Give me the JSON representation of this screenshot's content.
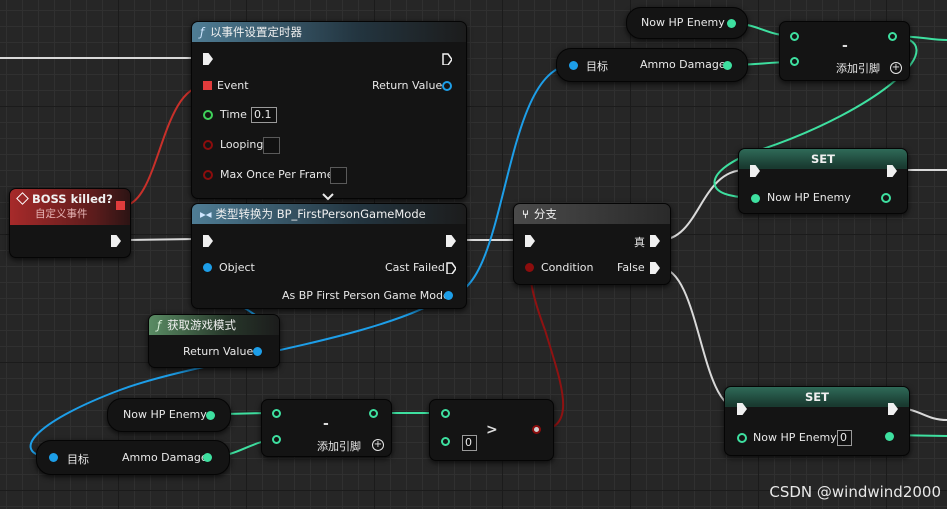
{
  "nodes": {
    "set_timer": {
      "title": "以事件设置定时器",
      "pin_event": "Event",
      "pin_return": "Return Value",
      "pin_time": "Time",
      "time_value": "0.1",
      "pin_looping": "Looping",
      "pin_max_once": "Max Once Per Frame"
    },
    "boss_killed": {
      "title": "BOSS killed?",
      "subtitle": "自定义事件"
    },
    "cast": {
      "title": "类型转换为 BP_FirstPersonGameMode",
      "pin_object": "Object",
      "pin_cast_failed": "Cast Failed",
      "pin_as": "As BP First Person Game Mode"
    },
    "get_game_mode": {
      "title": "获取游戏模式",
      "pin_return": "Return Value"
    },
    "branch": {
      "title": "分支",
      "pin_true": "真",
      "pin_condition": "Condition",
      "pin_false": "False"
    },
    "top_now_hp": {
      "label": "Now HP Enemy"
    },
    "top_target_ammo": {
      "target": "目标",
      "ammo": "Ammo Damage"
    },
    "top_subtract": {
      "symbol": "-",
      "add_pin": "添加引脚"
    },
    "set_top": {
      "title": "SET",
      "pin": "Now HP Enemy"
    },
    "set_bottom": {
      "title": "SET",
      "pin": "Now HP Enemy",
      "value": "0"
    },
    "bottom_now_hp": {
      "label": "Now HP Enemy"
    },
    "bottom_target_ammo": {
      "target": "目标",
      "ammo": "Ammo Damage"
    },
    "bottom_subtract": {
      "symbol": "-",
      "add_pin": "添加引脚"
    },
    "greater": {
      "symbol": ">",
      "value": "0"
    }
  },
  "watermark": "CSDN @windwind2000",
  "colors": {
    "exec": "#f0f0f0",
    "object_pin": "#1d9ee8",
    "float_pin": "#3ee0a0",
    "bool_pin": "#8c0d0d",
    "delegate_pin": "#d33a3a",
    "int_pin": "#3fd15a"
  }
}
